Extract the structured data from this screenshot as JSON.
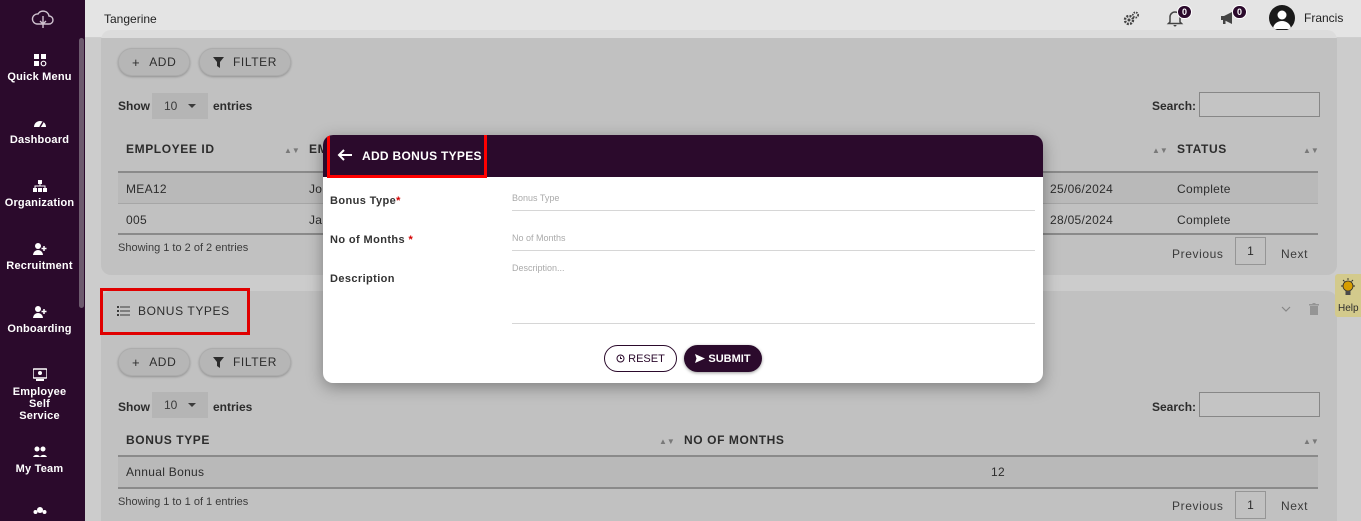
{
  "app": {
    "brand": "Tangerine"
  },
  "sidebar": {
    "items": [
      {
        "label": "Quick Menu",
        "icon": "quick-menu-icon"
      },
      {
        "label": "Dashboard",
        "icon": "dashboard-icon"
      },
      {
        "label": "Organization",
        "icon": "organization-icon"
      },
      {
        "label": "Recruitment",
        "icon": "recruitment-icon"
      },
      {
        "label": "Onboarding",
        "icon": "onboarding-icon"
      },
      {
        "label": "Employee Self Service",
        "icon": "self-service-icon"
      },
      {
        "label": "My Team",
        "icon": "team-icon"
      }
    ]
  },
  "topbar": {
    "notifications_count": "0",
    "announcements_count": "0",
    "user_name": "Francis"
  },
  "card1": {
    "add_label": "ADD",
    "filter_label": "FILTER",
    "show_label": "Show",
    "entries_value": "10",
    "entries_label": "entries",
    "search_label": "Search:",
    "columns": [
      "EMPLOYEE ID",
      "EM",
      "STATUS"
    ],
    "rows": [
      {
        "id": "MEA12",
        "name": "Jo",
        "date": "25/06/2024",
        "status": "Complete"
      },
      {
        "id": "005",
        "name": "Ja",
        "date": "28/05/2024",
        "status": "Complete"
      }
    ],
    "info": "Showing 1 to 2 of 2 entries",
    "previous": "Previous",
    "page": "1",
    "next": "Next"
  },
  "card2": {
    "title": "BONUS TYPES",
    "add_label": "ADD",
    "filter_label": "FILTER",
    "show_label": "Show",
    "entries_value": "10",
    "entries_label": "entries",
    "search_label": "Search:",
    "columns": [
      "BONUS TYPE",
      "NO OF MONTHS"
    ],
    "rows": [
      {
        "bonus_type": "Annual Bonus",
        "months": "12"
      }
    ],
    "info": "Showing 1 to 1 of 1 entries",
    "previous": "Previous",
    "page": "1",
    "next": "Next"
  },
  "modal": {
    "title": "ADD BONUS TYPES",
    "fields": [
      {
        "label": "Bonus Type",
        "required": "*",
        "placeholder": "Bonus Type"
      },
      {
        "label": "No of Months ",
        "required": "*",
        "placeholder": "No of Months"
      },
      {
        "label": "Description",
        "required": "",
        "placeholder": "Description..."
      }
    ],
    "reset_label": "RESET",
    "submit_label": "SUBMIT"
  },
  "help": {
    "label": "Help"
  },
  "colors": {
    "primary": "#2b0a2c",
    "highlight": "#ff0000",
    "help_bg": "#f1e6a0"
  }
}
